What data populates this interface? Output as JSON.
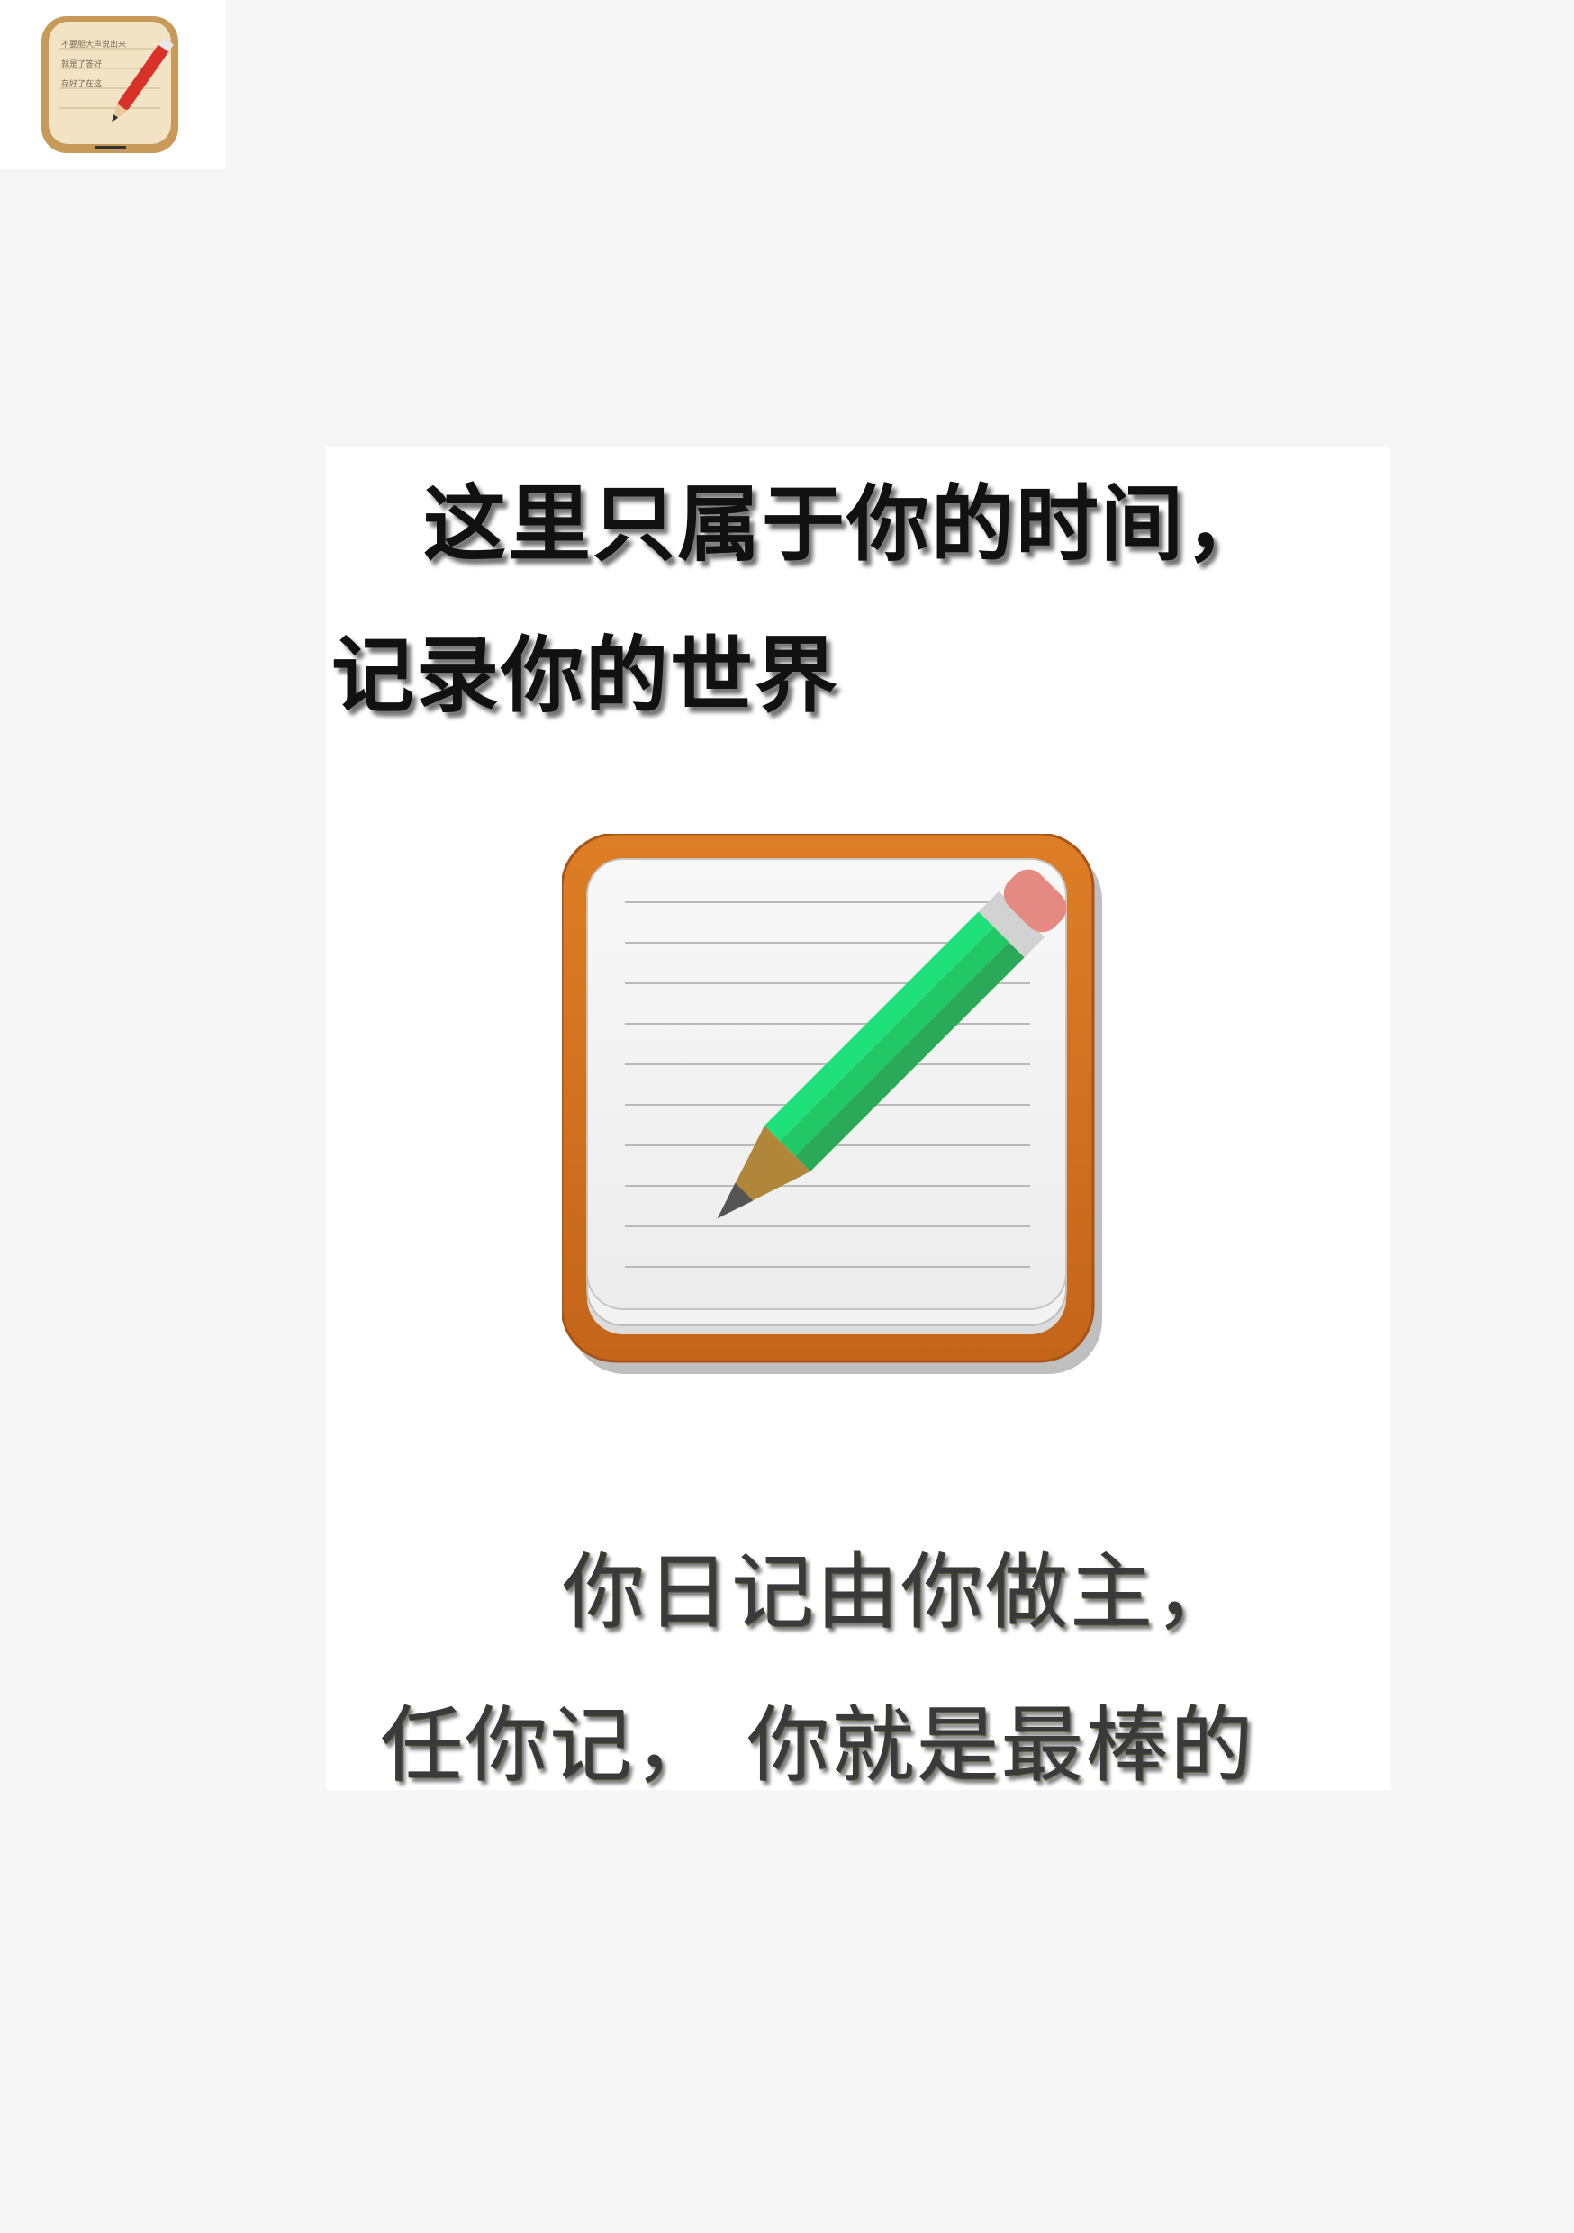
{
  "app_icon": {
    "name": "notebook-pencil-icon",
    "handwriting": [
      "不要胆大声说出来",
      "就是了答好",
      "存好了在这"
    ]
  },
  "poster": {
    "heading_line1": "这里只属于你的时间，",
    "heading_line2": "记录你的世界",
    "slogan_line1": "你日记由你做主，",
    "slogan_line2": "任你记，   你就是最棒的"
  },
  "illustration": {
    "name": "notepad-pencil-icon",
    "colors": {
      "frame": "#d3731f",
      "paper": "#f4f4f4",
      "pencil_body": "#22d36b",
      "pencil_tip_wood": "#b0863a",
      "eraser": "#e58a82"
    }
  }
}
